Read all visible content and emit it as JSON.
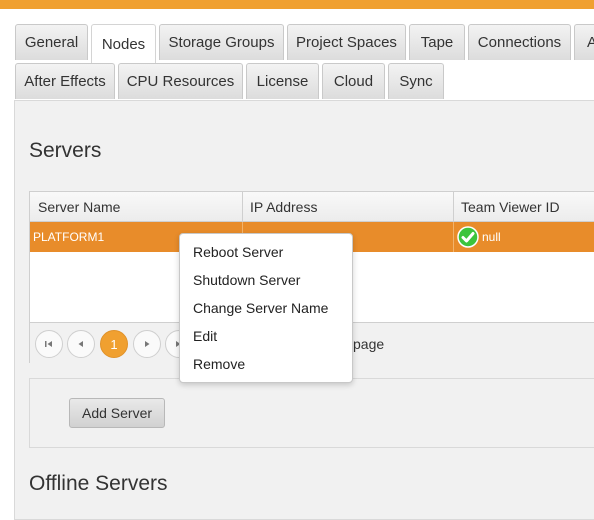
{
  "colors": {
    "accent": "#f0a030",
    "selected_row": "#e88c2a",
    "status_ok": "#3cc43c"
  },
  "tabs_row1": [
    {
      "label": "General"
    },
    {
      "label": "Nodes",
      "active": true
    },
    {
      "label": "Storage Groups"
    },
    {
      "label": "Project Spaces"
    },
    {
      "label": "Tape"
    },
    {
      "label": "Connections"
    },
    {
      "label": "A"
    }
  ],
  "tabs_row2": [
    {
      "label": "After Effects"
    },
    {
      "label": "CPU Resources"
    },
    {
      "label": "License"
    },
    {
      "label": "Cloud"
    },
    {
      "label": "Sync"
    }
  ],
  "servers": {
    "title": "Servers",
    "columns": [
      "Server Name",
      "IP Address",
      "Team Viewer ID"
    ],
    "rows": [
      {
        "server_name": "PLATFORM1",
        "ip_address": "",
        "team_viewer_id": "null",
        "status_icon": "check-icon"
      }
    ],
    "pager": {
      "current_page": "1",
      "per_page_text": "page"
    },
    "add_button": "Add Server"
  },
  "context_menu": {
    "items": [
      "Reboot Server",
      "Shutdown Server",
      "Change Server Name",
      "Edit",
      "Remove"
    ]
  },
  "offline_servers": {
    "title": "Offline Servers"
  }
}
